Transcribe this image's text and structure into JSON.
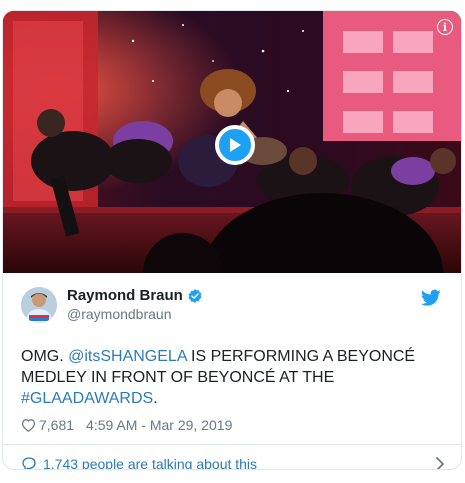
{
  "tweet": {
    "author": {
      "display_name": "Raymond Braun",
      "handle": "@raymondbraun",
      "verified": true
    },
    "text": {
      "part1": "OMG. ",
      "mention": "@itsSHANGELA",
      "part2": " IS PERFORMING A BEYONCÉ MEDLEY IN FRONT OF BEYONCÉ AT THE ",
      "hashtag": "#GLAADAWARDS",
      "part3": "."
    },
    "likes": "7,681",
    "timestamp": "4:59 AM - Mar 29, 2019",
    "talking": "1,743 people are talking about this",
    "media": {
      "type": "video",
      "backdrop_brand": "glaad"
    }
  },
  "icons": {
    "play": "play-icon",
    "info": "info-icon",
    "verified": "verified-badge-icon",
    "twitter": "twitter-bird-icon",
    "heart": "heart-icon",
    "chat": "speech-bubble-icon",
    "chevron": "chevron-right-icon"
  },
  "colors": {
    "link": "#2b7bb9",
    "twitter_blue": "#1da1f2",
    "muted": "#697882",
    "text": "#1c2022",
    "border": "#e1e8ed"
  }
}
